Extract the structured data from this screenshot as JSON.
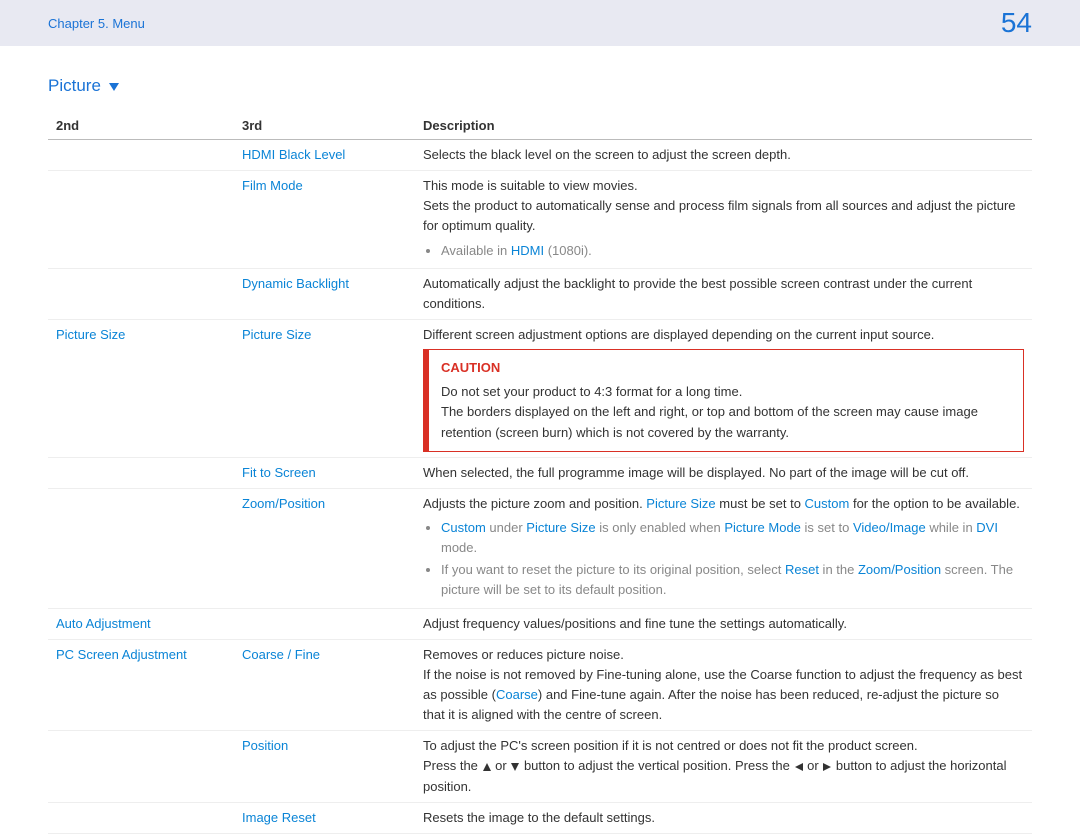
{
  "header": {
    "breadcrumb": "Chapter 5. Menu",
    "page_number": "54"
  },
  "section": {
    "title": "Picture"
  },
  "columns": {
    "c1": "2nd",
    "c2": "3rd",
    "c3": "Description"
  },
  "rows": {
    "hdmi_black_level": {
      "third": "HDMI Black Level",
      "desc": "Selects the black level on the screen to adjust the screen depth."
    },
    "film_mode": {
      "third": "Film Mode",
      "desc_line1": "This mode is suitable to view movies.",
      "desc_line2": "Sets the product to automatically sense and process film signals from all sources and adjust the picture for optimum quality.",
      "bullet_prefix": "Available in ",
      "bullet_link": "HDMI",
      "bullet_suffix": " (1080i)."
    },
    "dynamic_backlight": {
      "third": "Dynamic Backlight",
      "desc": "Automatically adjust the backlight to provide the best possible screen contrast under the current conditions."
    },
    "picture_size_group": {
      "second": "Picture Size"
    },
    "picture_size": {
      "third": "Picture Size",
      "desc": "Different screen adjustment options are displayed depending on the current input source.",
      "caution_title": "CAUTION",
      "caution_l1": "Do not set your product to 4:3 format for a long time.",
      "caution_l2": "The borders displayed on the left and right, or top and bottom of the screen may cause image retention (screen burn) which is not covered by the warranty."
    },
    "fit_to_screen": {
      "third": "Fit to Screen",
      "desc": "When selected, the full programme image will be displayed. No part of the image will be cut off."
    },
    "zoom_position": {
      "third": "Zoom/Position",
      "desc_pre": "Adjusts the picture zoom and position. ",
      "desc_link1": "Picture Size",
      "desc_mid": " must be set to ",
      "desc_link2": "Custom",
      "desc_post": " for the option to be available.",
      "b1_w1": "Custom",
      "b1_t1": " under ",
      "b1_w2": "Picture Size",
      "b1_t2": " is only enabled when ",
      "b1_w3": "Picture Mode",
      "b1_t3": " is set to ",
      "b1_w4": "Video/Image",
      "b1_t4": " while in ",
      "b1_w5": "DVI",
      "b1_t5": " mode.",
      "b2_t1": "If you want to reset the picture to its original position, select ",
      "b2_w1": "Reset",
      "b2_t2": " in the ",
      "b2_w2": "Zoom/Position",
      "b2_t3": " screen. The picture will be set to its default position."
    },
    "auto_adjustment": {
      "second": "Auto Adjustment",
      "desc": "Adjust frequency values/positions and fine tune the settings automatically."
    },
    "pc_screen_adjustment": {
      "second": "PC Screen Adjustment"
    },
    "coarse_fine": {
      "third": "Coarse / Fine",
      "l1": "Removes or reduces picture noise.",
      "l2_pre": "If the noise is not removed by Fine-tuning alone, use the Coarse function to adjust the frequency as best as possible (",
      "l2_link": "Coarse",
      "l2_post": ") and Fine-tune again. After the noise has been reduced, re-adjust the picture so that it is aligned with the centre of screen."
    },
    "position": {
      "third": "Position",
      "l1": "To adjust the PC's screen position if it is not centred or does not fit the product screen.",
      "l2_a": "Press the ",
      "l2_b": " or ",
      "l2_c": " button to adjust the vertical position. Press the ",
      "l2_d": " or ",
      "l2_e": " button to adjust the horizontal position."
    },
    "image_reset": {
      "third": "Image Reset",
      "desc": "Resets the image to the default settings."
    }
  }
}
